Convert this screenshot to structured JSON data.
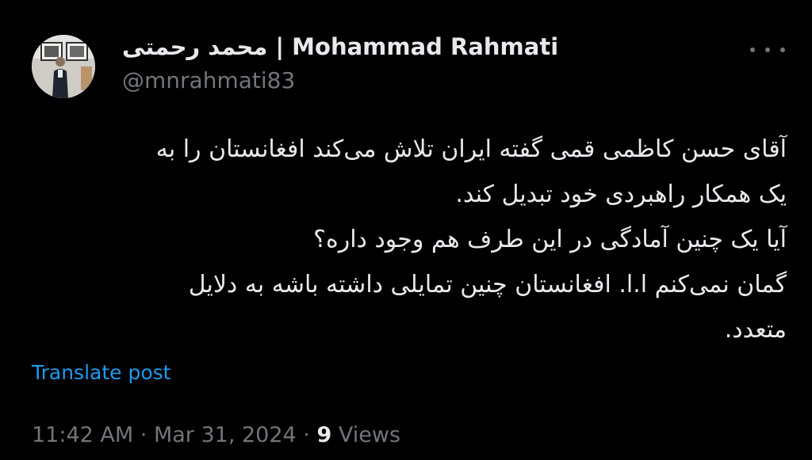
{
  "author": {
    "display_name": "محمد رحمتی | Mohammad Rahmati",
    "handle": "@mnrahmati83",
    "avatar_icon": "profile-photo"
  },
  "post": {
    "lines": [
      "آقای حسن کاظمی قمی گفته ایران تلاش می‌کند افغانستان را به",
      "یک همکار راهبردی خود تبدیل کند.",
      "آیا یک چنین آمادگی در این طرف هم وجود داره؟",
      "گمان نمی‌کنم ا.ا. افغانستان چنین تمایلی داشته باشه به دلایل",
      "متعدد."
    ],
    "translate_label": "Translate post"
  },
  "meta": {
    "time": "11:42 AM",
    "separator": "·",
    "date": "Mar 31, 2024",
    "views_count": "9",
    "views_label": "Views"
  },
  "colors": {
    "background": "#000000",
    "text": "#e7e9ea",
    "muted": "#71767b",
    "link": "#1d9bf0"
  }
}
